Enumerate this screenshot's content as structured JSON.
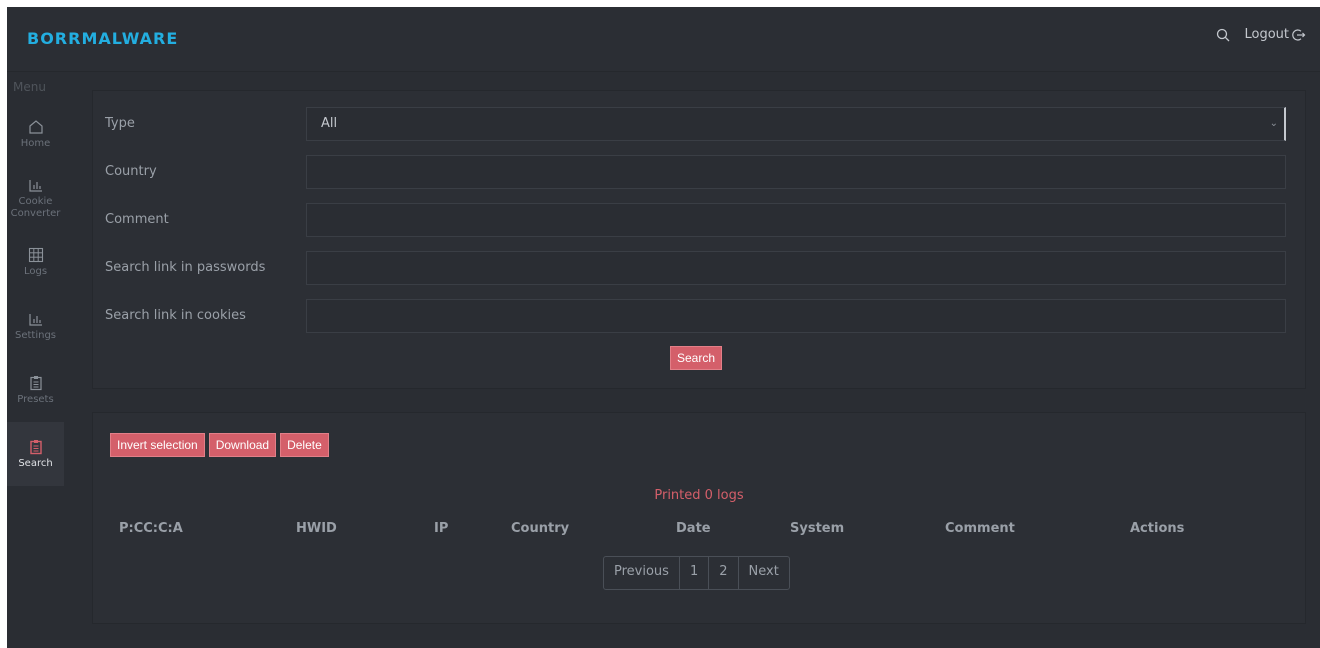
{
  "brand": "BORRMALWARE",
  "topbar": {
    "logout_label": "Logout"
  },
  "sidebar": {
    "menu_title": "Menu",
    "items": [
      {
        "label": "Home",
        "icon": "home-icon"
      },
      {
        "label": "Cookie Converter",
        "icon": "chart-icon"
      },
      {
        "label": "Logs",
        "icon": "grid-icon"
      },
      {
        "label": "Settings",
        "icon": "chart-icon"
      },
      {
        "label": "Presets",
        "icon": "clipboard-icon"
      },
      {
        "label": "Search",
        "icon": "clipboard-icon",
        "active": true
      }
    ]
  },
  "filters": {
    "type_label": "Type",
    "type_value": "All",
    "country_label": "Country",
    "comment_label": "Comment",
    "passwords_label": "Search link in passwords",
    "cookies_label": "Search link in cookies",
    "search_button": "Search"
  },
  "results": {
    "buttons": {
      "invert": "Invert selection",
      "download": "Download",
      "delete": "Delete"
    },
    "status": "Printed 0 logs",
    "columns": [
      "P:CC:C:A",
      "HWID",
      "IP",
      "Country",
      "Date",
      "System",
      "Comment",
      "Actions"
    ],
    "pager": {
      "previous": "Previous",
      "pages": [
        "1",
        "2"
      ],
      "next": "Next"
    }
  },
  "colors": {
    "accent": "#d45f6a",
    "brand": "#23aee0",
    "background": "#2a2d33"
  }
}
